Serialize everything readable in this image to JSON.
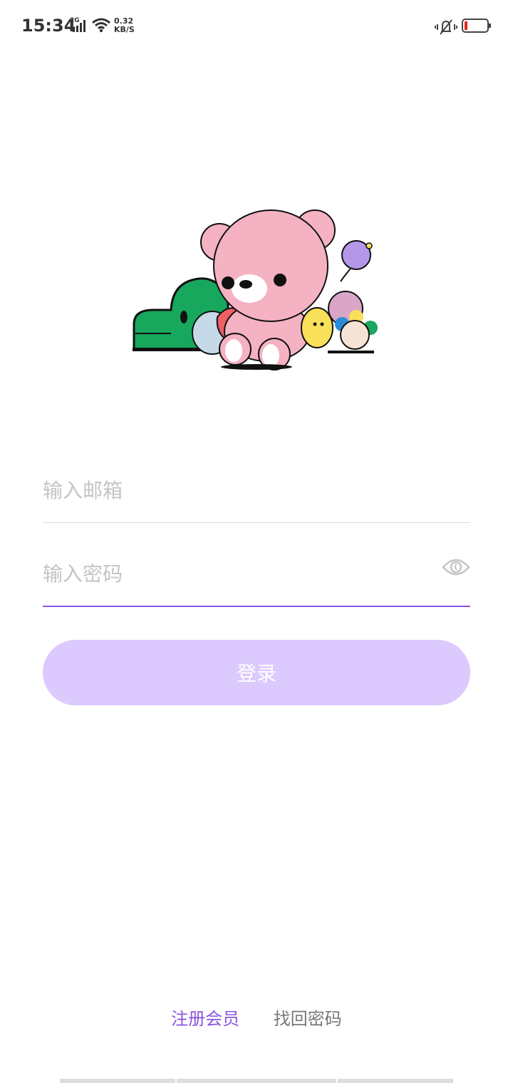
{
  "status_bar": {
    "time": "15:34",
    "network_type": "2G",
    "speed_value": "0.32",
    "speed_unit": "KB/S"
  },
  "form": {
    "email_placeholder": "输入邮箱",
    "password_placeholder": "输入密码",
    "login_label": "登录"
  },
  "links": {
    "register": "注册会员",
    "forgot_password": "找回密码"
  },
  "colors": {
    "accent": "#8a55e0",
    "login_button_disabled": "#dccafe",
    "placeholder": "#c4c4c4"
  },
  "icons": {
    "password_toggle": "eye-icon"
  }
}
